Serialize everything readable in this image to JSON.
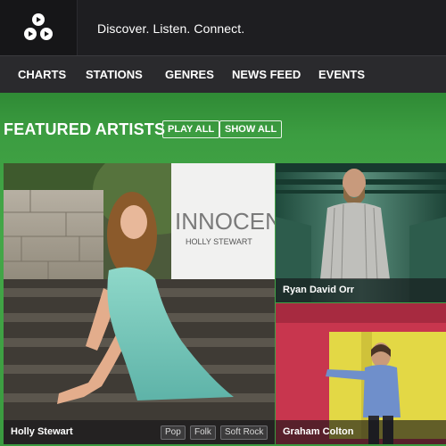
{
  "header": {
    "tagline": "Discover. Listen. Connect.",
    "logo": "triangle-circles-logo-icon"
  },
  "nav": {
    "items": [
      {
        "label": "CHARTS"
      },
      {
        "label": "STATIONS"
      },
      {
        "label": "GENRES"
      },
      {
        "label": "NEWS FEED"
      },
      {
        "label": "EVENTS"
      }
    ]
  },
  "featured": {
    "title": "FEATURED ARTISTS",
    "play_all": "PLAY ALL",
    "show_all": "SHOW ALL",
    "accent_color": "#44a748",
    "artists": [
      {
        "name": "Holly Stewart",
        "album_title": "INNOCENT",
        "album_artist": "HOLLY STEWART",
        "tags": [
          "Pop",
          "Folk",
          "Soft Rock"
        ]
      },
      {
        "name": "Ryan David Orr"
      },
      {
        "name": "Graham Colton"
      }
    ]
  }
}
